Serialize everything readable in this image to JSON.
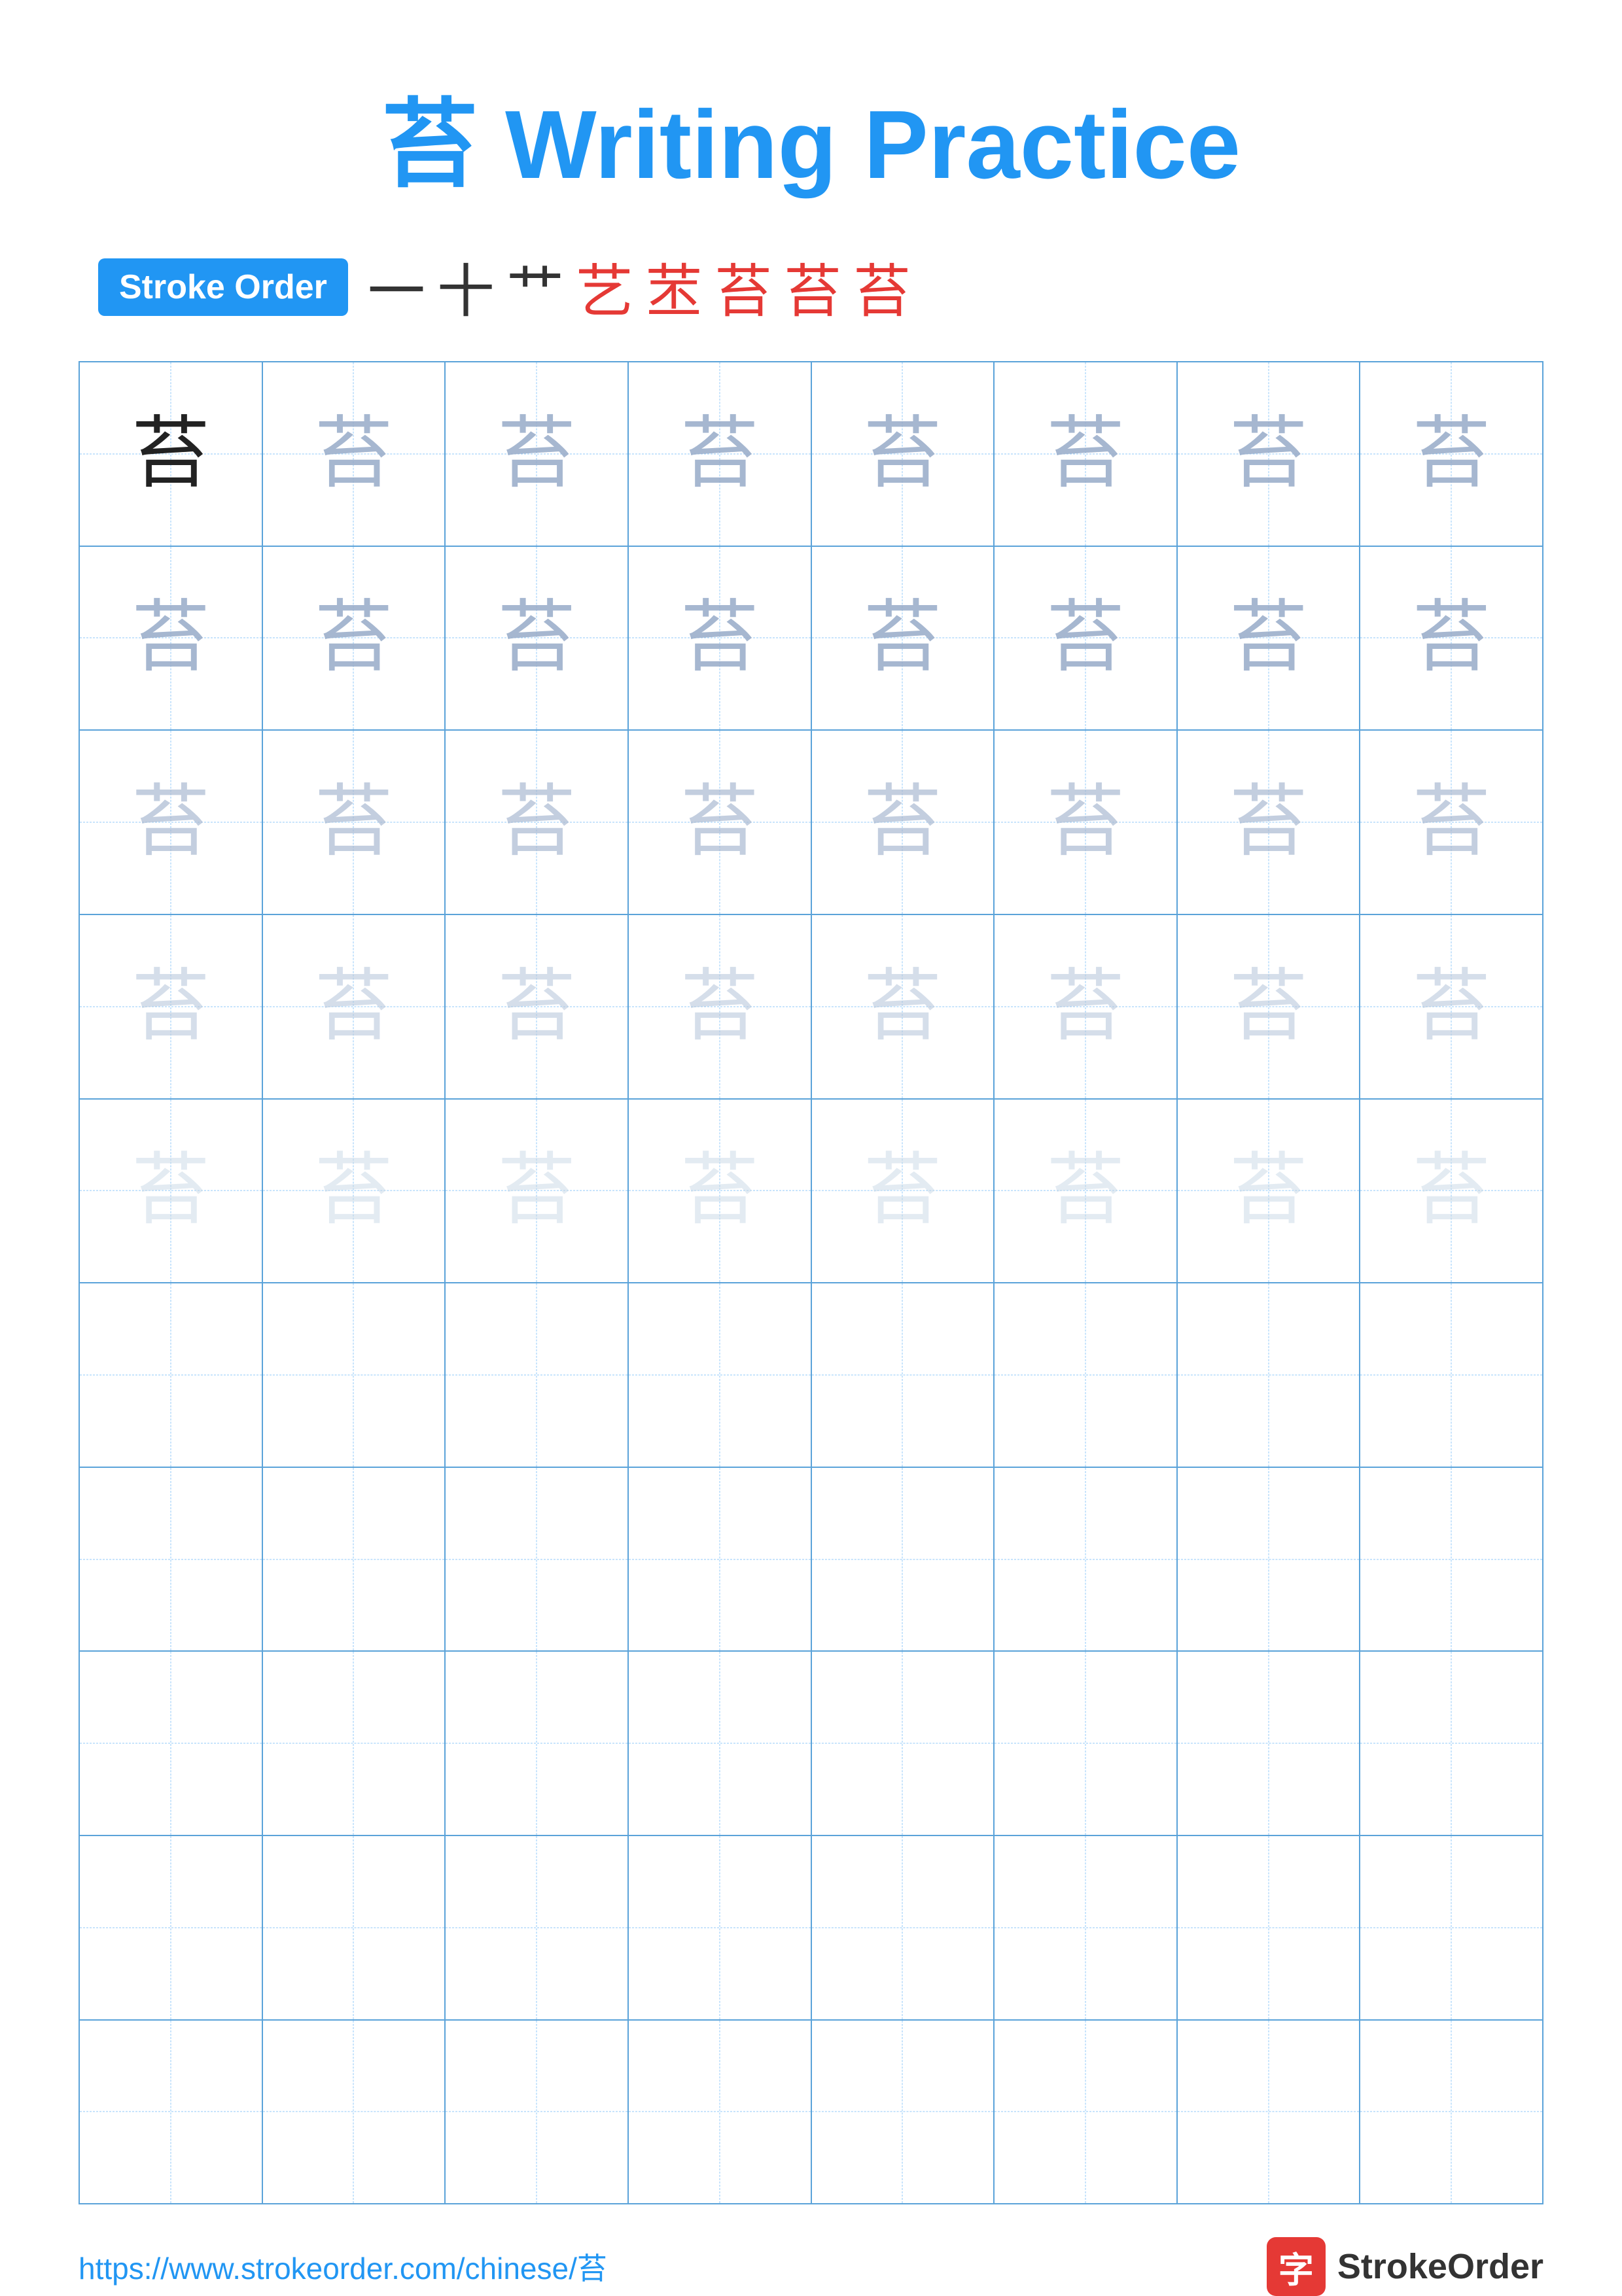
{
  "title": "苔 Writing Practice",
  "stroke_order": {
    "badge_label": "Stroke Order",
    "chars": [
      "一",
      "十",
      "艹",
      "艺",
      "苤",
      "苔",
      "苔",
      "苔"
    ],
    "char_colors": [
      "dark",
      "dark",
      "dark",
      "red",
      "red",
      "red",
      "red",
      "red"
    ]
  },
  "character": "苔",
  "grid": {
    "cols": 8,
    "rows": 10,
    "filled_rows": 5,
    "row_opacities": [
      "dark",
      "med1",
      "med2",
      "med3",
      "light"
    ]
  },
  "footer": {
    "url": "https://www.strokeorder.com/chinese/苔",
    "logo_char": "字",
    "logo_text": "StrokeOrder"
  }
}
